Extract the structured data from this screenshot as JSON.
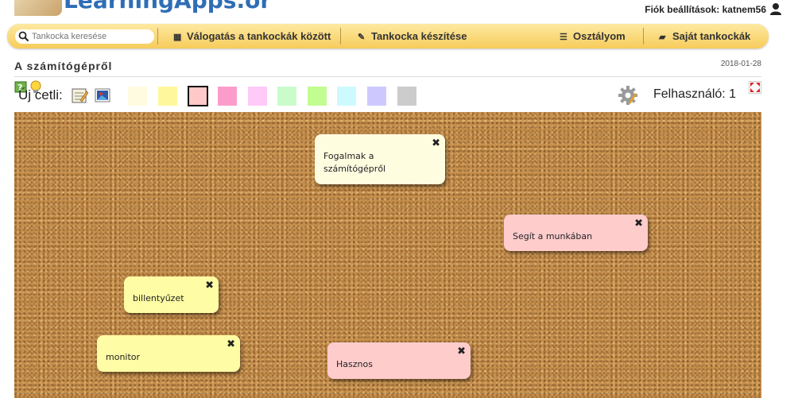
{
  "header": {
    "logo_text": "LearningApps.org",
    "account_label": "Fiók beállítások: katnem56"
  },
  "nav": {
    "search_placeholder": "Tankocka keresése",
    "items": [
      {
        "label": "Válogatás a tankockák között",
        "icon": "grid-icon"
      },
      {
        "label": "Tankocka készítése",
        "icon": "pencil-icon"
      },
      {
        "label": "Osztályom",
        "icon": "list-icon"
      },
      {
        "label": "Saját tankockák",
        "icon": "folder-icon"
      }
    ]
  },
  "page": {
    "title": "A számítógépről",
    "date": "2018-01-28"
  },
  "toolbar": {
    "new_note_label": "Új cetli:",
    "swatches": [
      "#fffbe0",
      "#fef79b",
      "#ffc9c9",
      "#fb9ccb",
      "#ffcaf8",
      "#cafbca",
      "#c1fd90",
      "#cdfaff",
      "#cdc9ff",
      "#cccccc"
    ],
    "selected_swatch": 2,
    "user_label": "Felhasználó: 1"
  },
  "notes": [
    {
      "text": "Fogalmak a számítógépről",
      "color": "#fffde0"
    },
    {
      "text": "Segít a munkában",
      "color": "#ffcccc"
    },
    {
      "text": "billentyűzet",
      "color": "#fefca4"
    },
    {
      "text": "monitor",
      "color": "#fefca4"
    },
    {
      "text": "Hasznos",
      "color": "#ffcccc"
    }
  ]
}
